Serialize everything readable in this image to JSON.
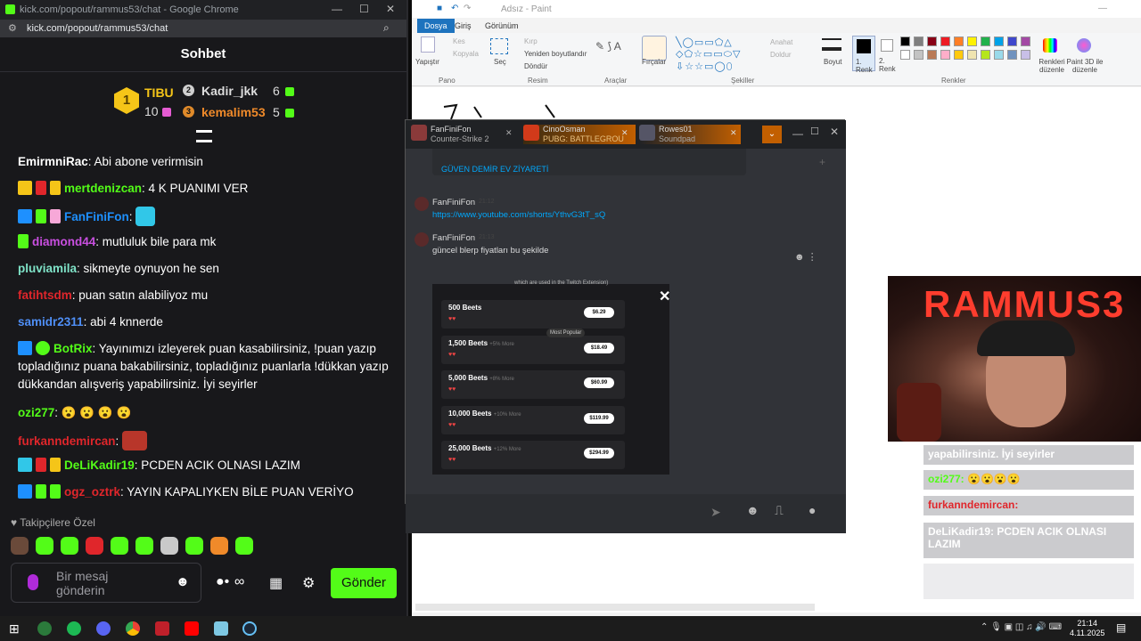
{
  "chrome": {
    "title": "kick.com/popout/rammus53/chat - Google Chrome",
    "url": "kick.com/popout/rammus53/chat"
  },
  "chat": {
    "header": "Sohbet",
    "leaderboard": {
      "first": {
        "rank": "1",
        "name": "TIBU",
        "count": "10"
      },
      "second": {
        "rank": "2",
        "name": "Kadir_jkk",
        "count": "6"
      },
      "third": {
        "rank": "3",
        "name": "kemalim53",
        "count": "5"
      }
    },
    "messages": [
      {
        "user": "EmirmniRac",
        "color": "#ffffff",
        "text": "Abi abone verirmisin"
      },
      {
        "user": "mertdenizcan",
        "color": "#53fc18",
        "text": "4 K PUANIMI VER"
      },
      {
        "user": "FanFiniFon",
        "color": "#1e90ff",
        "text": ""
      },
      {
        "user": "diamond44",
        "color": "#c94fe0",
        "text": "mutluluk bile para mk"
      },
      {
        "user": "pluviamila",
        "color": "#7fe3c8",
        "text": "sikmeyte oynuyon he sen"
      },
      {
        "user": "fatihtsdm",
        "color": "#e0262b",
        "text": "puan satın alabiliyoz mu"
      },
      {
        "user": "samidr2311",
        "color": "#4f8ff7",
        "text": "abi 4 knnerde"
      },
      {
        "user": "BotRix",
        "color": "#53fc18",
        "text": "Yayınımızı izleyerek puan kasabilirsiniz, !puan yazıp topladığınız puana bakabilirsiniz, topladığınız puanlarla !dükkan yazıp dükkandan alışveriş yapabilirsiniz. İyi seyirler"
      },
      {
        "user": "ozi277",
        "color": "#53fc18",
        "text": "😮 😮 😮 😮"
      },
      {
        "user": "furkanndemircan",
        "color": "#e0262b",
        "text": ""
      },
      {
        "user": "DeLiKadir19",
        "color": "#53fc18",
        "text": "PCDEN ACIK OLNASI LAZIM"
      },
      {
        "user": "ogz_oztrk",
        "color": "#e0262b",
        "text": "YAYIN KAPALIYKEN BİLE PUAN VERİYO"
      }
    ],
    "followers_label": "Takipçilere Özel",
    "input_placeholder": "Bir mesaj gönderin",
    "send_label": "Gönder"
  },
  "paint": {
    "title": "Adsız - Paint",
    "tabs": [
      "Dosya",
      "Giriş",
      "Görünüm"
    ],
    "paste": "Yapıştır",
    "cut": "Kes",
    "copy": "Kopyala",
    "select": "Seç",
    "crop": "Kırp",
    "resize": "Yeniden boyutlandır",
    "rotate": "Döndür",
    "brushes": "Fırçalar",
    "outline": "Anahat",
    "fill": "Doldur",
    "size": "Boyut",
    "color1": "1. Renk",
    "color2": "2. Renk",
    "edit_colors": "Renkleri düzenle",
    "paint3d": "Paint 3D ile düzenle",
    "groups": [
      "Pano",
      "Resim",
      "Araçlar",
      "Şekiller",
      "Renkler"
    ]
  },
  "discord": {
    "tabs": [
      {
        "name": "FanFiniFon",
        "sub": "Counter-Strike 2"
      },
      {
        "name": "CinoOsman",
        "sub": "PUBG: BATTLEGROU"
      },
      {
        "name": "Rowes01",
        "sub": "Soundpad"
      }
    ],
    "top_text": "GÜVEN DEMİR EV ZİYARETİ",
    "msg1_user": "FanFiniFon",
    "msg1_time": "21:12",
    "msg1_link": "https://www.youtube.com/shorts/YthvG3tT_sQ",
    "msg2_user": "FanFiniFon",
    "msg2_time": "21:13",
    "msg2_text": "güncel blerp fiyatları bu şekilde",
    "image_caption": "which are used in the Twitch Extension)",
    "packages": [
      {
        "name": "500 Beets",
        "extra": "",
        "price": "$6.29"
      },
      {
        "name": "1,500 Beets",
        "extra": "+5% More",
        "price": "$18.49"
      },
      {
        "name": "5,000 Beets",
        "extra": "+8% More",
        "price": "$60.99"
      },
      {
        "name": "10,000 Beets",
        "extra": "+10% More",
        "price": "$119.99"
      },
      {
        "name": "25,000 Beets",
        "extra": "+12% More",
        "price": "$294.99"
      }
    ],
    "most_popular": "Most Popular"
  },
  "webcam": {
    "text": "RAMMUS3"
  },
  "overlay_chat": [
    "yapabilirsiniz. İyi seyirler",
    "ozi277: 😮😮😮😮",
    "furkanndemircan:",
    "DeLiKadir19: PCDEN ACIK OLNASI LAZIM"
  ],
  "taskbar": {
    "time": "21:14",
    "date": "4.11.2025"
  }
}
